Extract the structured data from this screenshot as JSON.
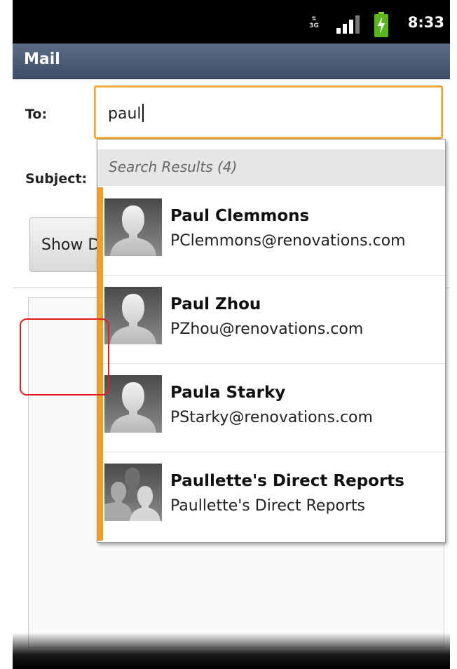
{
  "status_bar": {
    "network": "3G",
    "time": "8:33"
  },
  "app": {
    "title": "Mail"
  },
  "form": {
    "to_label": "To:",
    "to_value": "paul",
    "subject_label": "Subject:",
    "show_button_label": "Show D"
  },
  "dropdown": {
    "header": "Search Results (4)",
    "results": [
      {
        "name": "Paul Clemmons",
        "email": "PClemmons@renovations.com",
        "avatar": "person-icon"
      },
      {
        "name": "Paul Zhou",
        "email": "PZhou@renovations.com",
        "avatar": "person-icon"
      },
      {
        "name": "Paula Starky",
        "email": "PStarky@renovations.com",
        "avatar": "person-icon"
      },
      {
        "name": "Paullette's Direct Reports",
        "email": "Paullette's Direct Reports",
        "avatar": "group-icon"
      }
    ]
  },
  "colors": {
    "accent": "#f2a024",
    "title_bar": "#4a5d75",
    "highlight": "#e02020"
  }
}
